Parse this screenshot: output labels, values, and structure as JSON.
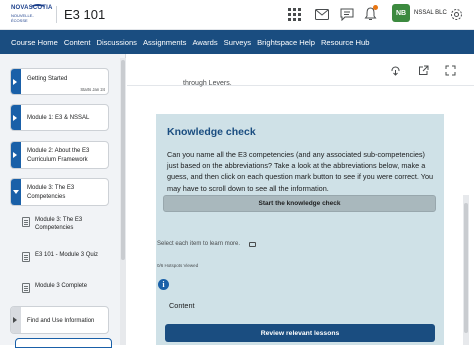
{
  "header": {
    "logo_line1": "NOVASCOTIA",
    "logo_line2": "NOUVELLE-ÉCOSSE",
    "course_title": "E3 101",
    "avatar_initials": "NB",
    "username": "NSSAL BLC"
  },
  "navbar": {
    "items": [
      "Course Home",
      "Content",
      "Discussions",
      "Assignments",
      "Awards",
      "Surveys",
      "Brightspace Help",
      "Resource Hub"
    ]
  },
  "sidebar": {
    "modules": [
      {
        "label": "Getting Started",
        "meta": "Starts Jan 24"
      },
      {
        "label": "Module 1: E3 & NSSAL"
      },
      {
        "label": "Module 2: About the E3 Curriculum Framework"
      },
      {
        "label": "Module 3: The E3 Competencies"
      },
      {
        "label": "Find and Use Information"
      }
    ],
    "subitems": [
      "Module 3: The E3 Competencies",
      "E3 101 - Module 3 Quiz",
      "Module 3 Complete"
    ]
  },
  "content": {
    "fragment": "through Levers.",
    "kc_title": "Knowledge check",
    "kc_desc": "Can you name all the E3 competencies (and any associated sub-competencies) just based on the abbreviations? Take a look at the abbreviations below, make a guess, and then click on each question mark button to see if you were correct. You may have to scroll down to see all the information.",
    "kc_button": "Start the knowledge check",
    "select_text": "Select each item to learn more.",
    "viewed": "0/6 Hotspots Viewed",
    "content_label": "Content",
    "review_button": "Review relevant lessons"
  },
  "colors": {
    "navbar": "#1a4d80",
    "accent": "#1a60a8",
    "kc_background": "#cfe1e7",
    "avatar": "#3c8a3f"
  }
}
